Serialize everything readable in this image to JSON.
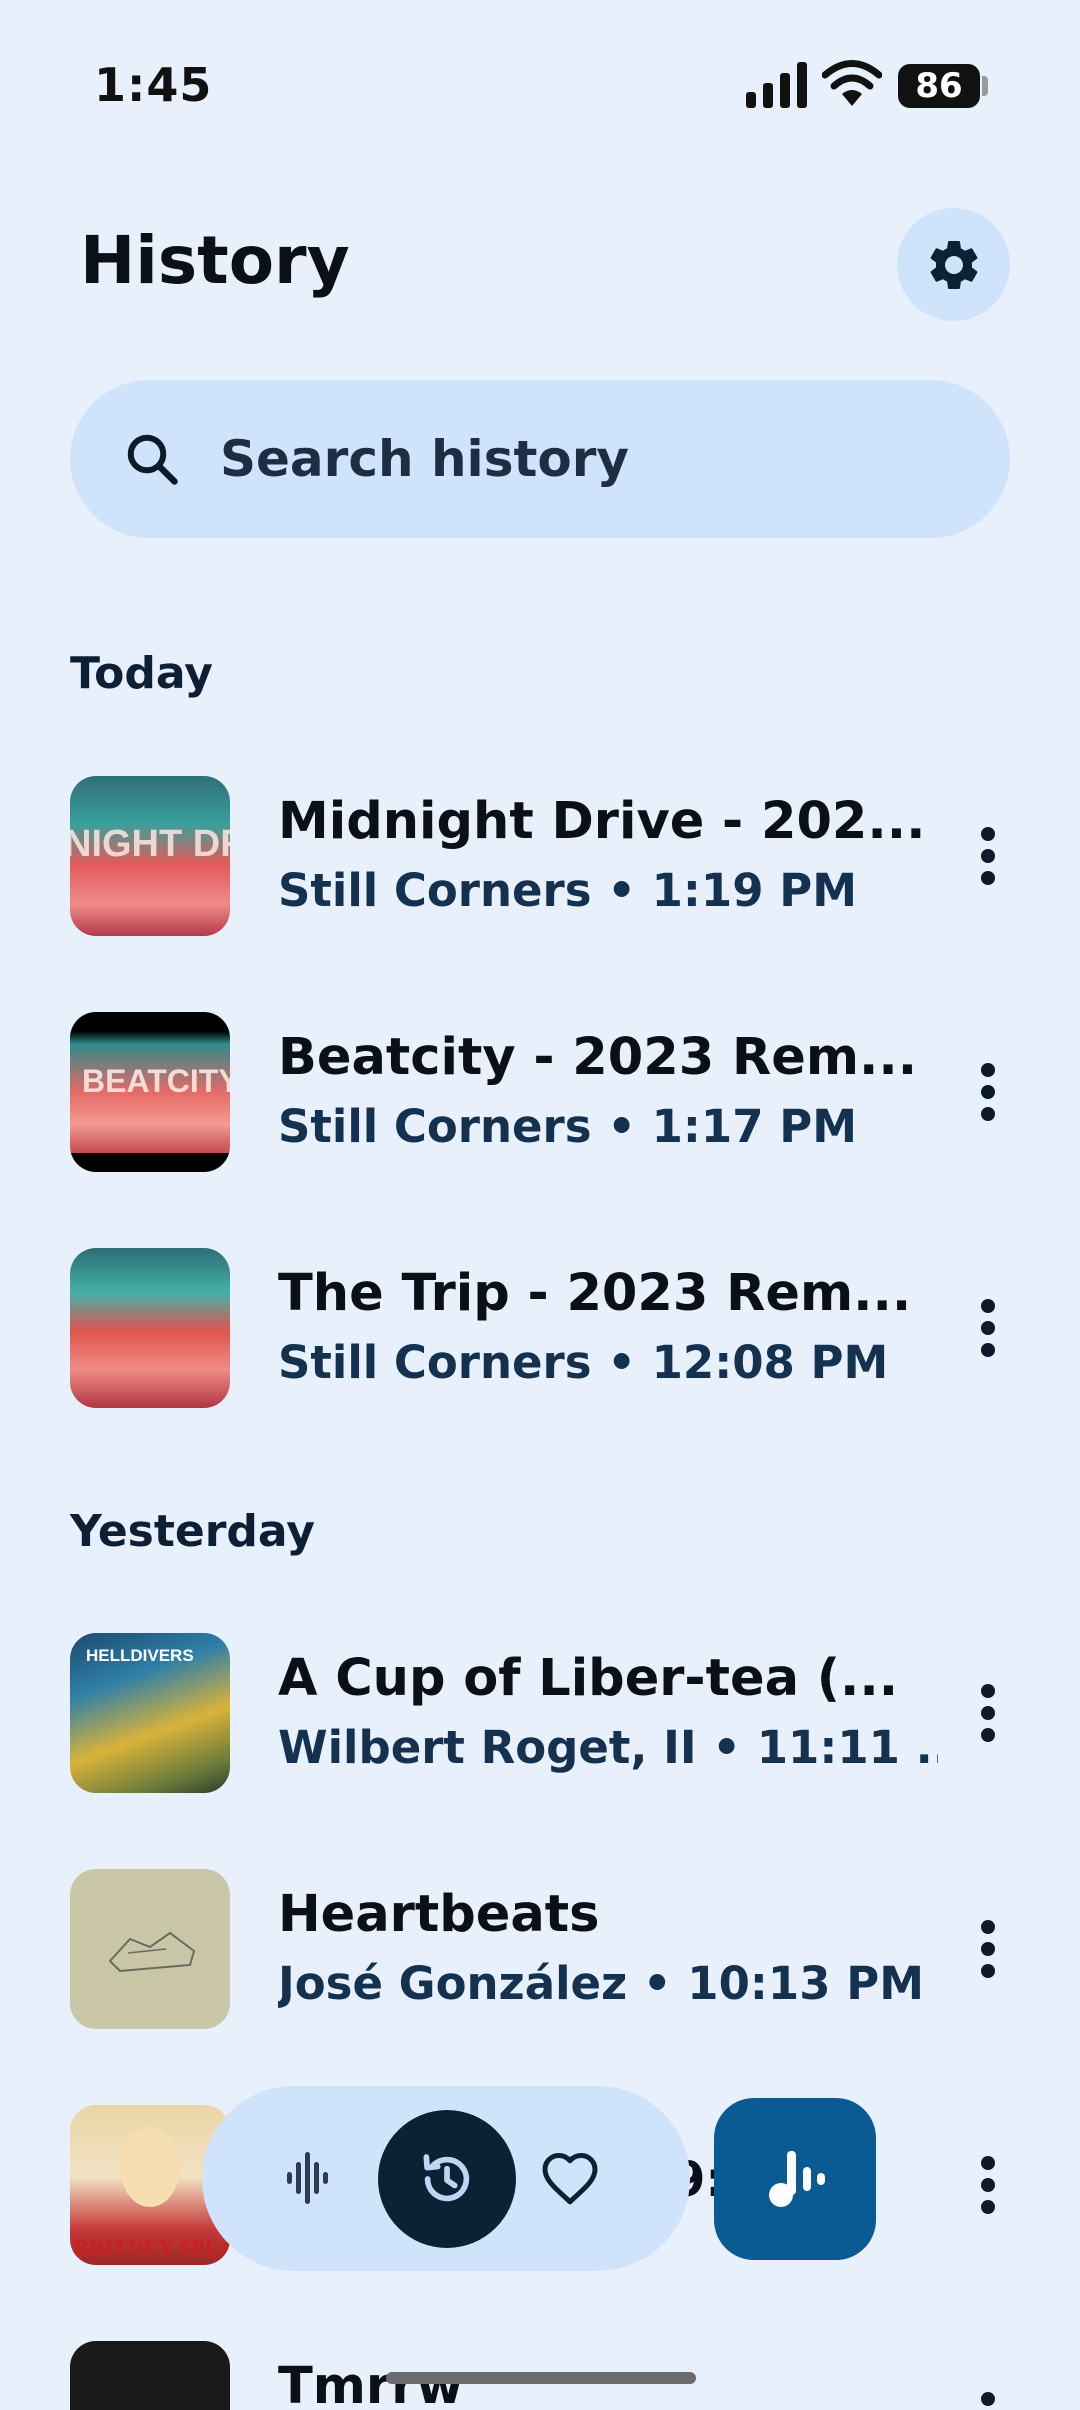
{
  "status_bar": {
    "time": "1:45",
    "battery": "86"
  },
  "header": {
    "title": "History"
  },
  "search": {
    "placeholder": "Search history"
  },
  "sections": [
    {
      "heading": "Today",
      "items": [
        {
          "title": "Midnight Drive - 202...",
          "subtitle": "Still Corners • 1:19 PM",
          "art_text": "NIGHT DR"
        },
        {
          "title": "Beatcity - 2023 Rem...",
          "subtitle": "Still Corners • 1:17 PM",
          "art_text": "BEATCITY"
        },
        {
          "title": "The Trip - 2023 Rem...",
          "subtitle": "Still Corners • 12:08 PM"
        }
      ]
    },
    {
      "heading": "Yesterday",
      "items": [
        {
          "title": "A Cup of Liber-tea (...",
          "subtitle": "Wilbert Roget, II • 11:11 ...",
          "art_text": "HELLDIVERS"
        },
        {
          "title": "Heartbeats",
          "subtitle": "José González • 10:13 PM"
        },
        {
          "title": "",
          "subtitle": "",
          "art_text": "BRITNEY SPEARS"
        },
        {
          "title": "Tmrrw",
          "subtitle": ""
        }
      ]
    }
  ],
  "peek_text": "9:",
  "colors": {
    "background": "#e8f0fc",
    "pill": "#cfe3fb",
    "accent": "#0a5a93",
    "active_nav": "#0c2134"
  },
  "icons": [
    "signal-icon",
    "wifi-icon",
    "gear-icon",
    "search-icon",
    "more-vert-icon",
    "waveform-icon",
    "history-icon",
    "heart-icon",
    "music-note-icon"
  ]
}
